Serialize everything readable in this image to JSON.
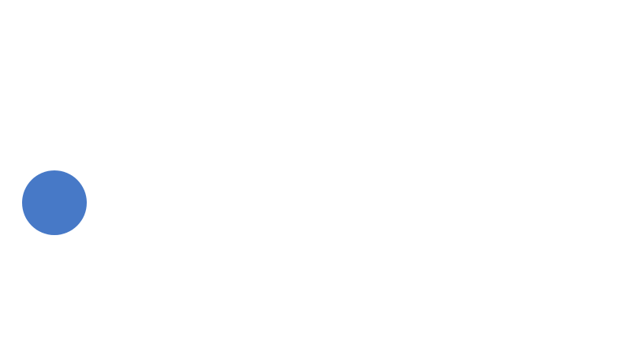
{
  "canvas": {
    "background_color": "#ffffff"
  },
  "shape": {
    "kind": "circle",
    "fill_color": "#4779c7"
  }
}
